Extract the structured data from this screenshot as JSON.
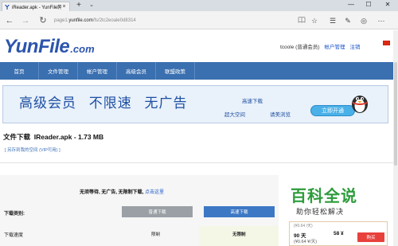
{
  "browser": {
    "tab_title": "iReader.apk - YunFile网",
    "tab_close": "×",
    "new_tab": "+",
    "tab_menu": "⌄",
    "window_controls": {
      "minimize": "—",
      "maximize": "☐",
      "close": "✕"
    },
    "nav": {
      "back": "←",
      "forward": "→",
      "refresh": "↻"
    },
    "address": {
      "prefix": "page1.",
      "domain": "yunfile.com",
      "path": "/fs/2tc2eoale0d8314"
    },
    "toolbar_icons": [
      "reading-view-icon",
      "favorite-star-icon",
      "favorites-hub-icon",
      "web-note-icon",
      "share-icon",
      "more-icon"
    ]
  },
  "site": {
    "logo_main": "YunFile",
    "logo_suffix": ".com",
    "user": {
      "name": "tcoole (普通会员)",
      "account_link": "帐户管理",
      "logout_link": "注销"
    },
    "nav": [
      "首页",
      "文件管理",
      "帐户管理",
      "高级会员",
      "联盟政策"
    ]
  },
  "banner": {
    "headline": [
      "高级会员",
      "不限速",
      "无广告"
    ],
    "features": [
      "高速下载",
      "超大空间",
      "请美浏览"
    ],
    "button": "立即开通"
  },
  "download": {
    "title_label": "文件下载",
    "file_name": "IReader.apk - 1.73 MB",
    "sub_info": "[ 另存到我的空间 (VIP可用) ]",
    "notice_text": "无须等待, 无广告, 无限制下载,",
    "notice_link": "点击这里",
    "type_label": "下载类别:",
    "normal_button": "普通下载",
    "fast_button": "高速下载",
    "speed_label": "下载速度",
    "speed_normal": "限制",
    "speed_fast": "无限制"
  },
  "watermark": {
    "main": "百科全说",
    "sub": "助你轻松解决"
  },
  "price_card": {
    "top": "(¥0.64 /天)",
    "days": "90 天",
    "amount": "58 ¥",
    "per_day": "(¥0.64 ¥/天)",
    "buy": "购买"
  },
  "colors": {
    "nav_bg": "#3a6fb0",
    "logo": "#2c55ad",
    "normal_btn": "#9aa0a6",
    "fast_btn": "#3d78c5",
    "buy_btn": "#e8413c",
    "watermark": "#2d9c3c"
  }
}
